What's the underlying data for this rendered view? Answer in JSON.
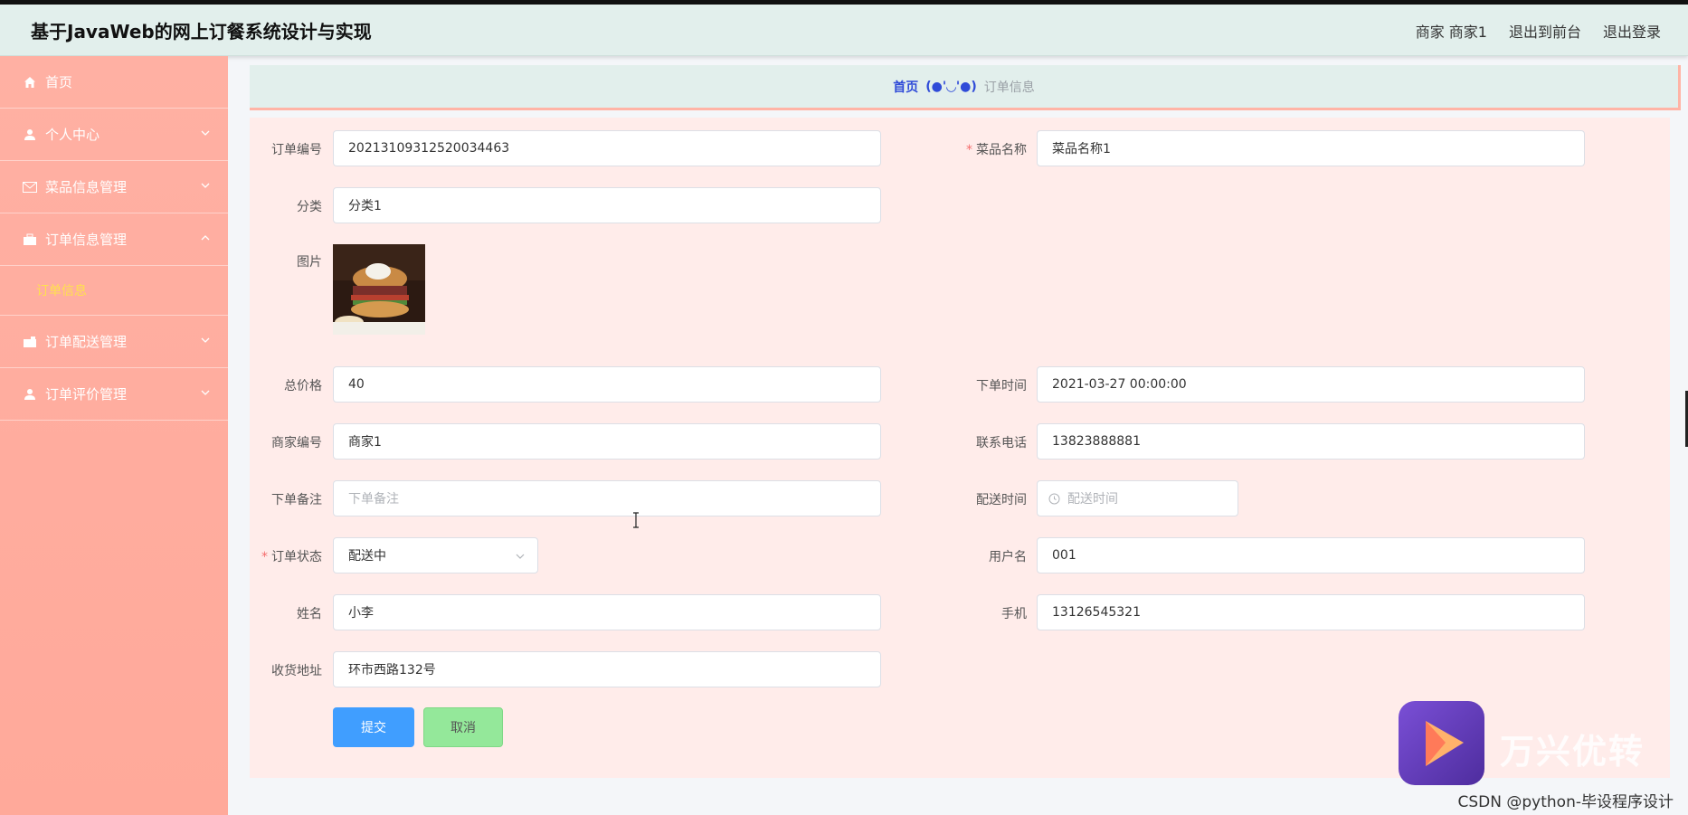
{
  "header": {
    "app_title": "基于JavaWeb的网上订餐系统设计与实现",
    "user_label": "商家 商家1",
    "back_to_front": "退出到前台",
    "logout": "退出登录"
  },
  "sidebar": {
    "items": [
      {
        "label": "首页",
        "icon": "home-icon"
      },
      {
        "label": "个人中心",
        "icon": "user-icon"
      },
      {
        "label": "菜品信息管理",
        "icon": "mail-icon"
      },
      {
        "label": "订单信息管理",
        "icon": "briefcase-icon"
      },
      {
        "label": "订单配送管理",
        "icon": "wallet-icon"
      },
      {
        "label": "订单评价管理",
        "icon": "user-icon"
      }
    ],
    "submenu": [
      "订单信息"
    ]
  },
  "breadcrumb": {
    "home": "首页",
    "separator": "(●'◡'●)",
    "current": "订单信息"
  },
  "form": {
    "order_no": {
      "label": "订单编号",
      "value": "20213109312520034463"
    },
    "dish_name": {
      "label": "菜品名称",
      "value": "菜品名称1",
      "required": "*"
    },
    "category": {
      "label": "分类",
      "value": "分类1"
    },
    "image": {
      "label": "图片"
    },
    "total_price": {
      "label": "总价格",
      "value": "40"
    },
    "order_time": {
      "label": "下单时间",
      "value": "2021-03-27 00:00:00"
    },
    "merchant_no": {
      "label": "商家编号",
      "value": "商家1"
    },
    "phone": {
      "label": "联系电话",
      "value": "13823888881"
    },
    "order_note": {
      "label": "下单备注",
      "placeholder": "下单备注"
    },
    "delivery_time": {
      "label": "配送时间",
      "placeholder": "配送时间"
    },
    "order_status": {
      "label": "订单状态",
      "value": "配送中",
      "required": "*"
    },
    "username": {
      "label": "用户名",
      "value": "001"
    },
    "name": {
      "label": "姓名",
      "value": "小李"
    },
    "mobile": {
      "label": "手机",
      "value": "13126545321"
    },
    "address": {
      "label": "收货地址",
      "value": "环市西路132号"
    },
    "submit_label": "提交",
    "cancel_label": "取消"
  },
  "watermark": {
    "brand": "万兴优转",
    "csdn": "CSDN @python-毕设程序设计"
  },
  "colors": {
    "primary": "#409eff",
    "sidebar": "#ffb0a3",
    "header": "#e2efec",
    "panel": "#ffecea",
    "active_submenu": "#ffe14d"
  }
}
